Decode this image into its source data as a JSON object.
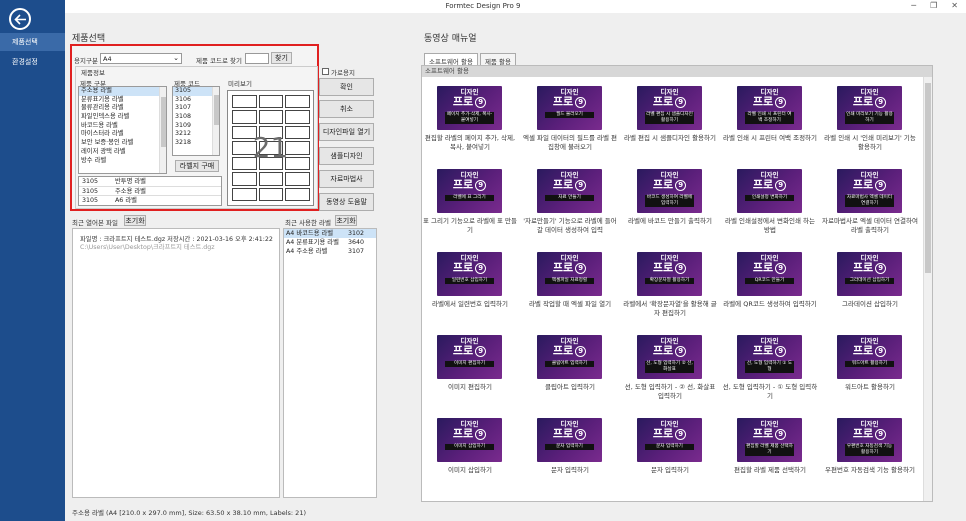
{
  "window": {
    "title": "Formtec Design Pro 9",
    "controls": [
      "─",
      "❐",
      "✕"
    ]
  },
  "sidebar": {
    "items": [
      {
        "label": "제품선택"
      },
      {
        "label": "환경설정"
      }
    ]
  },
  "product": {
    "section_title": "제품선택",
    "paper_label": "용지구분",
    "paper_value": "A4",
    "code_search_label": "제품 코드로 찾기",
    "code_search_value": "",
    "find_button": "찾기",
    "info_group_label": "제품정보",
    "category_header": "제품 구분",
    "code_header": "제품 코드",
    "preview_header": "미리보기",
    "categories": [
      "주소용 라벨",
      "분류표기용 라벨",
      "물류관리용 라벨",
      "파일인덱스용 라벨",
      "바코드용 라벨",
      "마이스터라 라벨",
      "보안 보증·봉인 라벨",
      "레이저 광택 라벨",
      "방수 라벨"
    ],
    "codes": [
      "3105",
      "3106",
      "3107",
      "3108",
      "3109",
      "3212",
      "3218"
    ],
    "preview_number": "21",
    "buy_button": "라벨지 구매",
    "detail_rows": [
      [
        "3105",
        "반투명 라벨"
      ],
      [
        "3105",
        "주소용 라벨"
      ],
      [
        "3105",
        "A6 라벨"
      ]
    ],
    "landscape_label": "가로용지"
  },
  "actions": [
    "확인",
    "취소",
    "디자인파일 열기",
    "샘플디자인",
    "자료마법사",
    "동영상 도움말"
  ],
  "recent_files": {
    "label": "최근 열어본 파일",
    "reset": "초기화",
    "line1": "파일명 : 크라프트지 테스트.dgz   저장시간 : 2021-03-16 오후 2:41:22",
    "line2": "C:\\Users\\User\\Desktop\\크라프트지 테스트.dgz"
  },
  "recent_labels": {
    "label": "최근 사용한 라벨",
    "reset": "초기화",
    "rows": [
      [
        "A4 바코드용 라벨",
        "3102"
      ],
      [
        "A4 분류표기용 라벨",
        "3640"
      ],
      [
        "A4 주소용 라벨",
        "3107"
      ]
    ]
  },
  "status": "주소용 라벨 (A4 [210.0 x 297.0 mm], Size: 63.50 x 38.10 mm, Labels: 21)",
  "manual": {
    "title": "동영상 매뉴얼",
    "tabs": [
      "소프트웨어 활용",
      "제품 활용"
    ],
    "subtitle": "소프트웨어 활용",
    "thumb_top": "디자인",
    "thumb_pro": "프로",
    "thumb_nine": "9",
    "videos": [
      {
        "banner": "페이지 추가·삭제, 복사·붙여넣기",
        "caption": "편집할 라벨의 페이지 추가, 삭제, 복사, 붙여넣기"
      },
      {
        "banner": "필드 불러오기",
        "caption": "엑셀 파일 데이터의 필드를 라벨 편집창에 불러오기"
      },
      {
        "banner": "라벨 편집 시 샘플디자인 활용하기",
        "caption": "라벨 편집 시 샘플디자인 활용하기"
      },
      {
        "banner": "라벨 인쇄 시 프린터 여백 조정하기",
        "caption": "라벨 인쇄 시 프린터 여백 조정하기"
      },
      {
        "banner": "인쇄 미리보기 기능 활용하기",
        "caption": "라벨 인쇄 시 '인쇄 미리보기' 기능 활용하기"
      },
      {
        "banner": "라벨에 표 그리기",
        "caption": "표 그리기 기능으로 라벨에 표 만들기"
      },
      {
        "banner": "자료 만들기",
        "caption": "'자료만들기' 기능으로 라벨에 들어갈 데이터 생성하여 입력"
      },
      {
        "banner": "바코드 생성하여 라벨에 입력하기",
        "caption": "라벨에 바코드 만들기 출력하기"
      },
      {
        "banner": "인쇄설정 변화하기",
        "caption": "라벨 인쇄설정에서 변화인쇄 하는 방법"
      },
      {
        "banner": "자료마법사 엑셀 데이터 연결하기",
        "caption": "자료마법사로 엑셀 데이터 연결하여 라벨 출력하기"
      },
      {
        "banner": "일련번호 삽입하기",
        "caption": "라벨에서 일련번호 입력하기"
      },
      {
        "banner": "엑셀파일 자료정렬",
        "caption": "라벨 작업할 때 엑셀 파일 열기"
      },
      {
        "banner": "확장문자열 활용하기",
        "caption": "라벨에서 '확장문자열'을 활용해 글자 편집하기"
      },
      {
        "banner": "QR코드 만들기",
        "caption": "라벨에 QR코드 생성하여 입력하기"
      },
      {
        "banner": "그라데이션 삽입하기",
        "caption": "그라데이션 삽입하기"
      },
      {
        "banner": "이미지 편집하기",
        "caption": "이미지 편집하기"
      },
      {
        "banner": "클립아트 입력하기",
        "caption": "클립아트 입력하기"
      },
      {
        "banner": "선, 도형 입력하기 ② 선, 화살표",
        "caption": "선, 도형 입력하기 - ② 선, 화살표 입력하기"
      },
      {
        "banner": "선, 도형 입력하기 ① 도형",
        "caption": "선, 도형 입력하기 - ① 도형 입력하기"
      },
      {
        "banner": "워드아트 활용하기",
        "caption": "워드아트 활용하기"
      },
      {
        "banner": "이미지 삽입하기",
        "caption": "이미지 삽입하기"
      },
      {
        "banner": "문자 입력하기",
        "caption": "문자 입력하기"
      },
      {
        "banner": "문자 입력하기",
        "caption": "문자 입력하기"
      },
      {
        "banner": "편집할 라벨 제품 선택하기",
        "caption": "편집할 라벨 제품 선택하기"
      },
      {
        "banner": "우편번호 자동검색 기능 활용하기",
        "caption": "우편번호 자동검색 기능 활용하기"
      }
    ]
  },
  "colors": {
    "sidebar": "#1d4d8c",
    "highlight": "#e02020",
    "thumb_bg": "#5a1f7a"
  }
}
